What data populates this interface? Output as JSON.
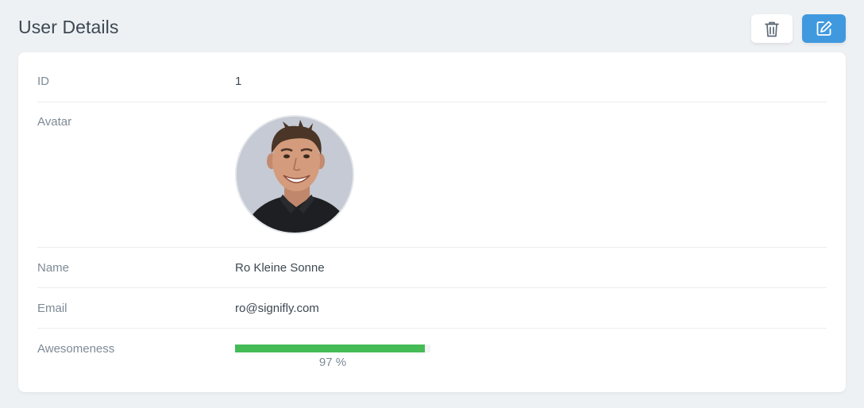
{
  "page": {
    "title": "User Details"
  },
  "actions": {
    "delete_icon": "trash-icon",
    "edit_icon": "edit-icon",
    "edit_color": "#4099de"
  },
  "user": {
    "id_label": "ID",
    "id_value": "1",
    "avatar_label": "Avatar",
    "name_label": "Name",
    "name_value": "Ro Kleine Sonne",
    "email_label": "Email",
    "email_value": "ro@signifly.com",
    "awesomeness_label": "Awesomeness",
    "awesomeness_percent": 97,
    "awesomeness_text": "97 %",
    "progress_color": "#45bb56"
  }
}
